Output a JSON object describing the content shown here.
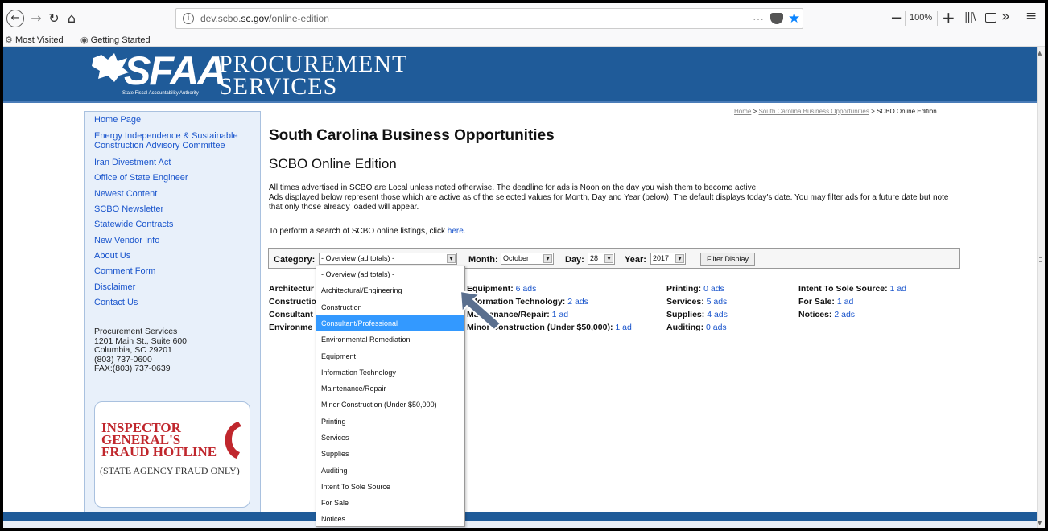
{
  "browser": {
    "url_host": "dev.scbo.",
    "url_domain": "sc.gov",
    "url_path": "/online-edition",
    "zoom": "100%",
    "bookmarks": [
      "Most Visited",
      "Getting Started"
    ]
  },
  "banner": {
    "logo_text": "SFAA",
    "logo_sub": "State Fiscal Accountability Authority",
    "title_line1": "PROCUREMENT",
    "title_line2": "SERVICES"
  },
  "nav": {
    "items": [
      "Home Page",
      "Energy Independence & Sustainable Construction Advisory Committee",
      "Iran Divestment Act",
      "Office of State Engineer",
      "Newest Content",
      "SCBO Newsletter",
      "Statewide Contracts",
      "New Vendor Info",
      "About Us",
      "Comment Form",
      "Disclaimer",
      "Contact Us"
    ],
    "address": [
      "Procurement Services",
      "1201 Main St., Suite 600",
      "Columbia, SC 29201",
      "(803) 737-0600",
      "FAX:(803) 737-0639"
    ],
    "hotline_lines": [
      "INSPECTOR",
      "GENERAL'S",
      "FRAUD HOTLINE"
    ],
    "hotline_sub": "(STATE AGENCY FRAUD ONLY)"
  },
  "breadcrumb": {
    "home": "Home",
    "sep": " > ",
    "section": "South Carolina Business Opportunities",
    "current": "SCBO Online Edition"
  },
  "main": {
    "title": "South Carolina Business Opportunities",
    "subtitle": "SCBO Online Edition",
    "para1": "All times advertised in SCBO are Local unless noted otherwise.  The deadline for ads is Noon on the day you wish them to become active.",
    "para2": "Ads displayed below represent those which are active as of the selected values for Month, Day and Year (below).  The default displays today's date.  You may filter ads for a future date but note that only those already loaded will appear.",
    "search_prefix": "To perform a search of SCBO online listings, click ",
    "search_link": "here",
    "search_suffix": "."
  },
  "filter": {
    "category_label": "Category:",
    "category_value": "- Overview (ad totals) -",
    "month_label": "Month:",
    "month_value": "October",
    "day_label": "Day:",
    "day_value": "28",
    "year_label": "Year:",
    "year_value": "2017",
    "button": "Filter Display"
  },
  "categories": {
    "col1": [
      {
        "name": "Architectur"
      },
      {
        "name": "Constructio"
      },
      {
        "name": "Consultant"
      },
      {
        "name": "Environme"
      }
    ],
    "col2": [
      {
        "name": "Equipment:",
        "count": "6 ads"
      },
      {
        "name": "Information Technology:",
        "count": "2 ads"
      },
      {
        "name": "Maintenance/Repair:",
        "count": "1 ad"
      },
      {
        "name": "Minor Construction (Under $50,000):",
        "count": "1 ad"
      }
    ],
    "col3": [
      {
        "name": "Printing:",
        "count": "0 ads"
      },
      {
        "name": "Services:",
        "count": "5 ads"
      },
      {
        "name": "Supplies:",
        "count": "4 ads"
      },
      {
        "name": "Auditing:",
        "count": "0 ads"
      }
    ],
    "col4": [
      {
        "name": "Intent To Sole Source:",
        "count": "1 ad"
      },
      {
        "name": "For Sale:",
        "count": "1 ad"
      },
      {
        "name": "Notices:",
        "count": "2 ads"
      }
    ]
  },
  "dropdown": {
    "options": [
      "- Overview (ad totals) -",
      "Architectural/Engineering",
      "Construction",
      "Consultant/Professional",
      "Environmental Remediation",
      "Equipment",
      "Information Technology",
      "Maintenance/Repair",
      "Minor Construction (Under $50,000)",
      "Printing",
      "Services",
      "Supplies",
      "Auditing",
      "Intent To Sole Source",
      "For Sale",
      "Notices"
    ],
    "highlighted": "Consultant/Professional"
  },
  "colors": {
    "banner": "#1f5b99",
    "link": "#1a55cc",
    "highlight": "#3399ff",
    "hotline_red": "#c0272d"
  }
}
